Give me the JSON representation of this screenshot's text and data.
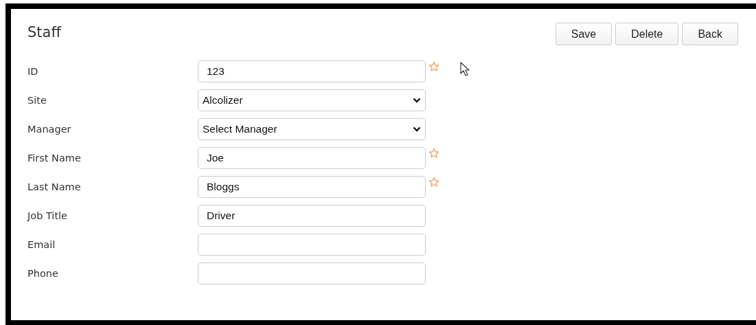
{
  "title": "Staff",
  "buttons": [
    "Save",
    "Delete",
    "Back"
  ],
  "fields": [
    {
      "label": "ID",
      "kind": "text",
      "value": "123",
      "required": true
    },
    {
      "label": "Site",
      "kind": "select",
      "value": "Alcolizer",
      "required": false
    },
    {
      "label": "Manager",
      "kind": "select",
      "value": "Select Manager",
      "required": false
    },
    {
      "label": "First Name",
      "kind": "text",
      "value": "Joe",
      "required": true
    },
    {
      "label": "Last Name",
      "kind": "text",
      "value": "Bloggs",
      "required": true
    },
    {
      "label": "Job Title",
      "kind": "text",
      "value": "Driver",
      "required": false
    },
    {
      "label": "Email",
      "kind": "text",
      "required": false
    },
    {
      "label": "Phone",
      "kind": "text",
      "required": false
    }
  ]
}
